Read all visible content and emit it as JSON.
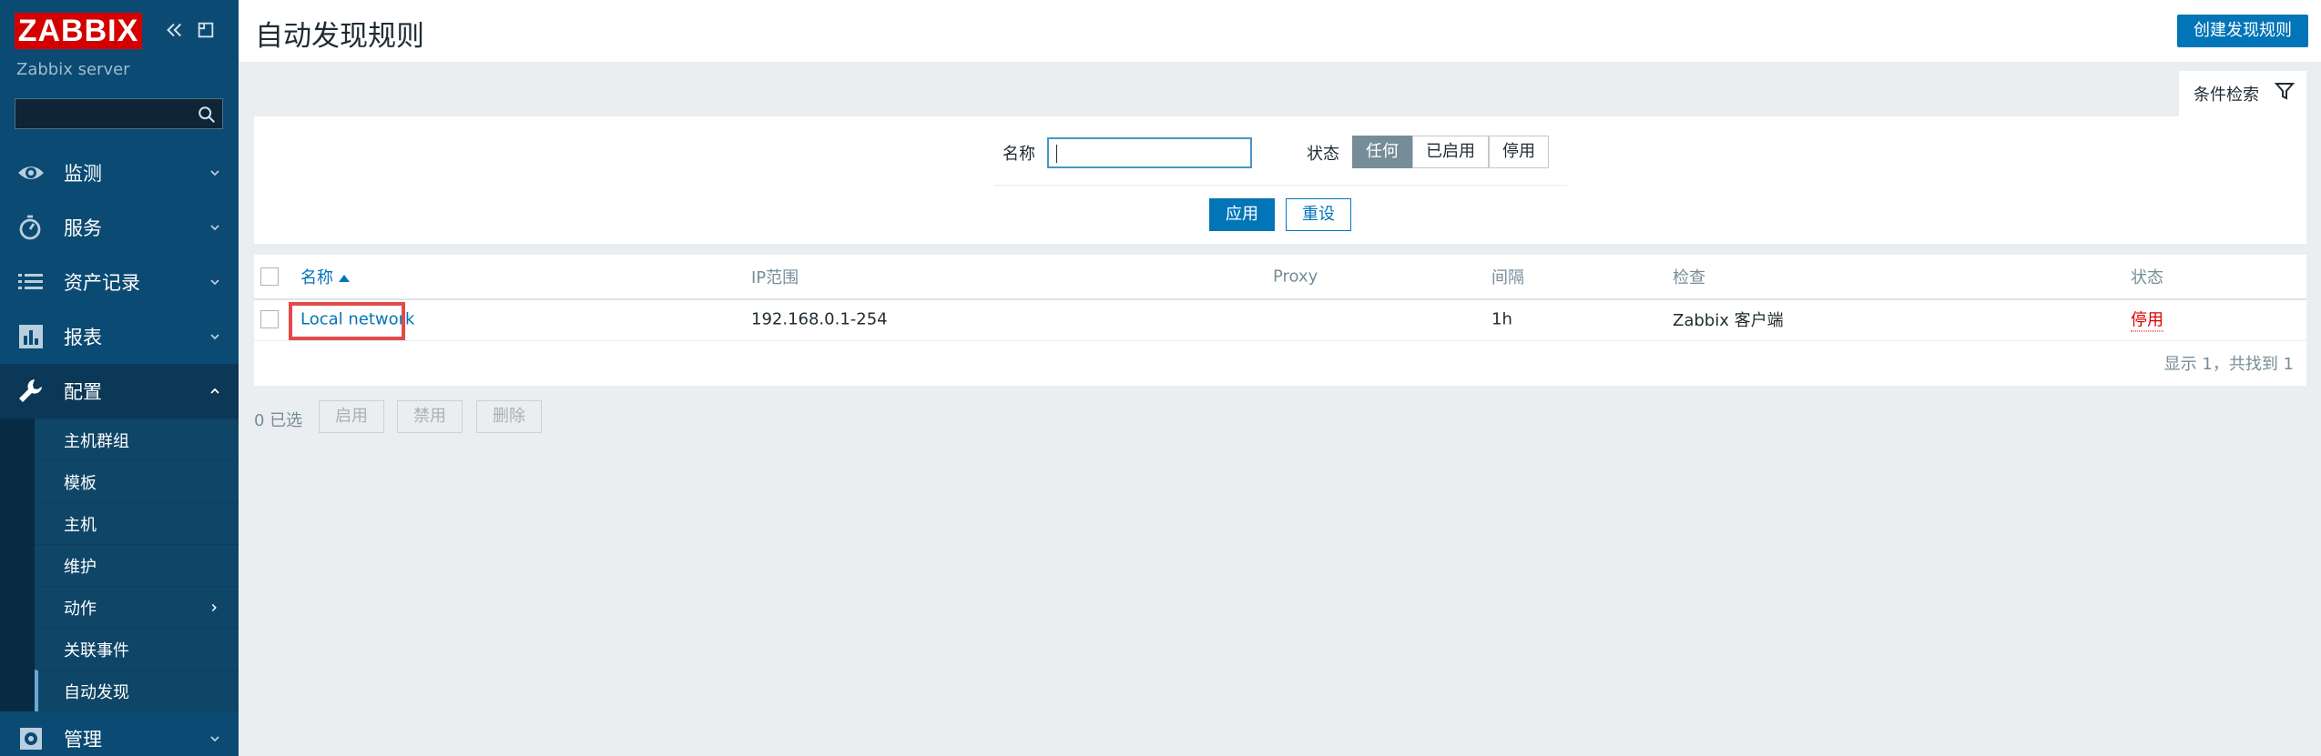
{
  "sidebar": {
    "logo": "ZABBIX",
    "server_name": "Zabbix server",
    "search_placeholder": "",
    "menu": [
      {
        "label": "监测",
        "icon": "eye-icon"
      },
      {
        "label": "服务",
        "icon": "stopwatch-icon"
      },
      {
        "label": "资产记录",
        "icon": "list-icon"
      },
      {
        "label": "报表",
        "icon": "chart-icon"
      },
      {
        "label": "配置",
        "icon": "wrench-icon"
      },
      {
        "label": "管理",
        "icon": "gear-icon"
      }
    ],
    "submenu": [
      {
        "label": "主机群组"
      },
      {
        "label": "模板"
      },
      {
        "label": "主机"
      },
      {
        "label": "维护"
      },
      {
        "label": "动作"
      },
      {
        "label": "关联事件"
      },
      {
        "label": "自动发现"
      }
    ]
  },
  "header": {
    "title": "自动发现规则",
    "create_button": "创建发现规则"
  },
  "filter": {
    "tab_label": "条件检索",
    "name_label": "名称",
    "name_value": "",
    "status_label": "状态",
    "status_options": [
      "任何",
      "已启用",
      "停用"
    ],
    "status_selected": "任何",
    "apply_label": "应用",
    "reset_label": "重设"
  },
  "table": {
    "headers": {
      "name": "名称",
      "ip_range": "IP范围",
      "proxy": "Proxy",
      "interval": "间隔",
      "checks": "检查",
      "status": "状态"
    },
    "rows": [
      {
        "name": "Local network",
        "ip_range": "192.168.0.1-254",
        "proxy": "",
        "interval": "1h",
        "checks": "Zabbix 客户端",
        "status": "停用"
      }
    ],
    "footer": "显示 1，共找到 1"
  },
  "actions": {
    "selected": "0 已选",
    "enable": "启用",
    "disable": "禁用",
    "delete": "删除"
  },
  "colors": {
    "sidebar": "#0b4a72",
    "accent": "#0275b8",
    "logo": "#d40000",
    "disabled_status": "#dc0000",
    "highlight": "#e34a4a"
  }
}
